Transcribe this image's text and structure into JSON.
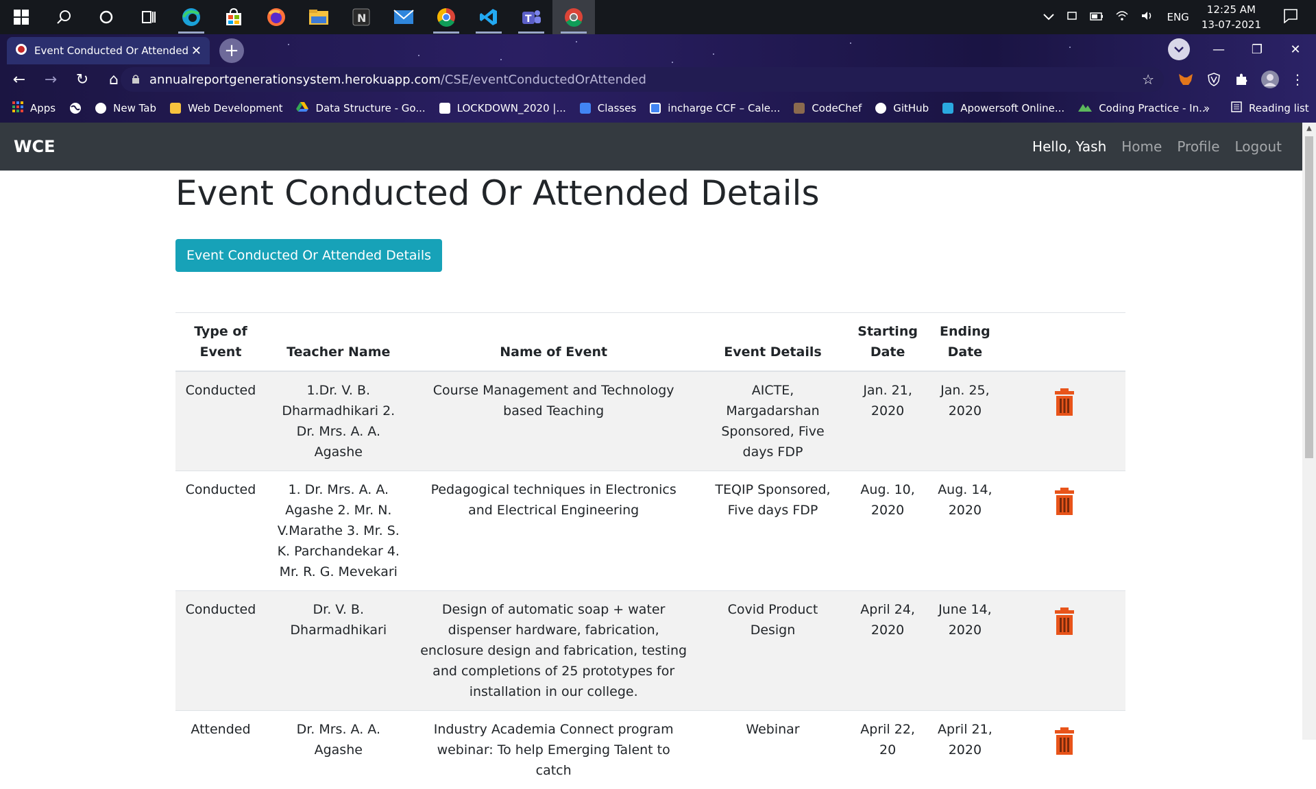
{
  "taskbar": {
    "time": "12:25 AM",
    "date": "13-07-2021",
    "lang": "ENG"
  },
  "browser": {
    "tab_title": "Event Conducted Or Attended De",
    "url_host": "annualreportgenerationsystem.herokuapp.com",
    "url_path": "/CSE/eventConductedOrAttended",
    "bookmarks": [
      {
        "label": "Apps",
        "color": "#e94235"
      },
      {
        "label": "New Tab",
        "color": "#ffffff"
      },
      {
        "label": "Web Development",
        "color": "#f6c23e"
      },
      {
        "label": "Data Structure - Go...",
        "color": "#34a853"
      },
      {
        "label": "LOCKDOWN_2020 |...",
        "color": "#ffffff"
      },
      {
        "label": "Classes",
        "color": "#4285f4"
      },
      {
        "label": "incharge CCF – Cale...",
        "color": "#4285f4"
      },
      {
        "label": "CodeChef",
        "color": "#8b6a4e"
      },
      {
        "label": "GitHub",
        "color": "#ffffff"
      },
      {
        "label": "Apowersoft Online...",
        "color": "#2aa9e0"
      },
      {
        "label": "Coding Practice - In...",
        "color": "#5cb85c"
      }
    ],
    "overflow": "»",
    "reading_list": "Reading list"
  },
  "navbar": {
    "brand": "WCE",
    "hello": "Hello, Yash",
    "home": "Home",
    "profile": "Profile",
    "logout": "Logout"
  },
  "page": {
    "title": "Event Conducted Or Attended Details",
    "button": "Event Conducted Or Attended Details"
  },
  "table": {
    "headers": [
      "Type of Event",
      "Teacher Name",
      "Name of Event",
      "Event Details",
      "Starting Date",
      "Ending Date",
      ""
    ],
    "rows": [
      [
        "Conducted",
        "1.Dr. V. B. Dharmadhikari 2. Dr. Mrs. A. A. Agashe",
        "Course Management and Technology based Teaching",
        "AICTE, Margadarshan Sponsored, Five days FDP",
        "Jan. 21, 2020",
        "Jan. 25, 2020"
      ],
      [
        "Conducted",
        "1. Dr. Mrs. A. A. Agashe 2. Mr. N. V.Marathe 3. Mr. S. K. Parchandekar 4. Mr. R. G. Mevekari",
        "Pedagogical techniques in Electronics and Electrical Engineering",
        "TEQIP Sponsored, Five days FDP",
        "Aug. 10, 2020",
        "Aug. 14, 2020"
      ],
      [
        "Conducted",
        "Dr. V. B. Dharmadhikari",
        "Design of automatic soap + water dispenser hardware, fabrication, enclosure design and fabrication, testing and completions of 25 prototypes for installation in our college.",
        "Covid Product Design",
        "April 24, 2020",
        "June 14, 2020"
      ],
      [
        "Attended",
        "Dr. Mrs. A. A. Agashe",
        "Industry Academia Connect program webinar: To help Emerging Talent to catch",
        "Webinar",
        "April 22, 20",
        "April 21, 2020"
      ]
    ]
  },
  "colors": {
    "navbar_bg": "#343a40",
    "button_bg": "#17a2b8",
    "trash": "#e8541a"
  }
}
